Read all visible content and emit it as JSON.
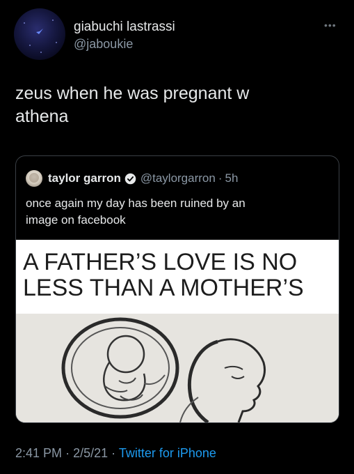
{
  "author": {
    "display_name": "giabuchi lastrassi",
    "handle": "@jaboukie"
  },
  "tweet": {
    "text_line1": "zeus when he was pregnant w",
    "text_line2": "athena"
  },
  "quoted_tweet": {
    "display_name": "taylor garron",
    "handle": "@taylorgarron",
    "separator": "·",
    "time": "5h",
    "text_line1": "once again my day has been ruined by an",
    "text_line2": "image on facebook",
    "image": {
      "caption_line1": "A FATHER’S LOVE IS NO",
      "caption_line2": "LESS THAN A MOTHER’S"
    }
  },
  "meta": {
    "time": "2:41 PM",
    "sep1": "·",
    "date": "2/5/21",
    "sep2": "·",
    "source": "Twitter for iPhone"
  },
  "colors": {
    "background": "#000000",
    "text": "#e7e9ea",
    "secondary": "#8b98a5",
    "link": "#1d9bf0",
    "verified": "#1d9bf0"
  },
  "icons": {
    "more": "more-horizontal-icon",
    "verified": "verified-badge-icon"
  }
}
